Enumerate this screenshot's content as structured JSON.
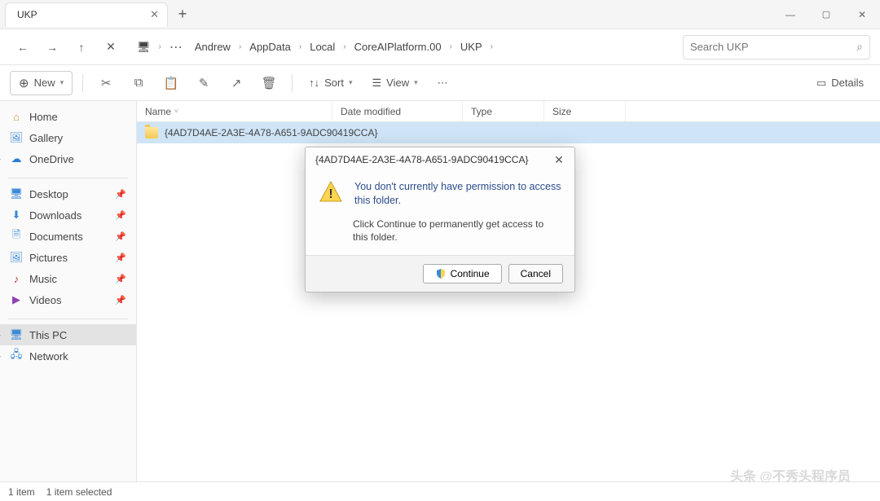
{
  "tab": {
    "title": "UKP"
  },
  "wincontrols": {
    "min": "—",
    "max": "▢",
    "close": "✕"
  },
  "nav": {
    "back": "←",
    "forward": "→",
    "up": "↑",
    "close": "✕",
    "breadcrumb": {
      "monitor_icon": "🖥",
      "more": "⋯",
      "items": [
        "Andrew",
        "AppData",
        "Local",
        "CoreAIPlatform.00",
        "UKP"
      ]
    },
    "search_placeholder": "Search UKP"
  },
  "toolbar": {
    "new": "New",
    "sort": "Sort",
    "view": "View",
    "more": "⋯",
    "details": "Details"
  },
  "sidebar": {
    "home": "Home",
    "gallery": "Gallery",
    "onedrive": "OneDrive",
    "desktop": "Desktop",
    "downloads": "Downloads",
    "documents": "Documents",
    "pictures": "Pictures",
    "music": "Music",
    "videos": "Videos",
    "thispc": "This PC",
    "network": "Network"
  },
  "columns": {
    "name": "Name",
    "date": "Date modified",
    "type": "Type",
    "size": "Size"
  },
  "row": {
    "name": "{4AD7D4AE-2A3E-4A78-A651-9ADC90419CCA}"
  },
  "dialog": {
    "title": "{4AD7D4AE-2A3E-4A78-A651-9ADC90419CCA}",
    "message": "You don't currently have permission to access this folder.",
    "sub": "Click Continue to permanently get access to this folder.",
    "continue": "Continue",
    "cancel": "Cancel"
  },
  "status": {
    "count": "1 item",
    "selected": "1 item selected"
  },
  "watermark": "头条 @不秀头程序员"
}
